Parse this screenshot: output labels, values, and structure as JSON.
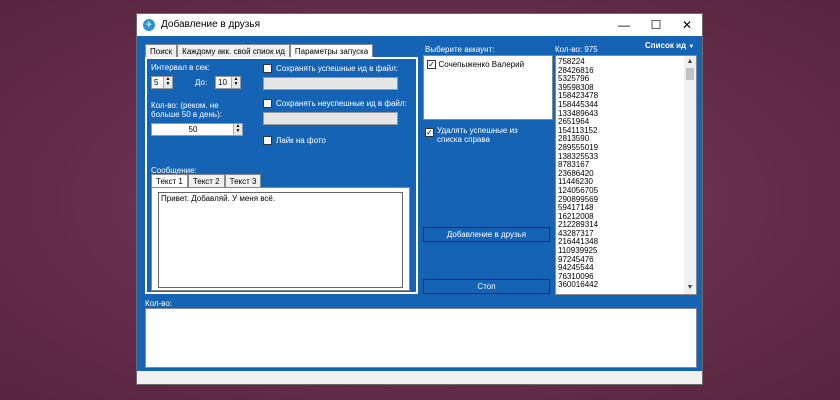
{
  "window": {
    "title": "Добавление в друзья"
  },
  "main_tabs": [
    "Поиск",
    "Каждому акк. свой спиок ид",
    "Параметры запуска"
  ],
  "params": {
    "interval_label": "Интервал в сек:",
    "interval_from": "5",
    "to_label": "До:",
    "interval_to": "10",
    "count_label": "Кол-во: (реком. не больше 50 в день):",
    "count_value": "50",
    "save_success_label": "Сохранять успешные ид в файл:",
    "save_fail_label": "Сохранять неуспешные ид в файл:",
    "like_photo_label": "Лайк на фото",
    "message_label": "Сообщение:"
  },
  "message_tabs": [
    "Текст 1",
    "Текст 2",
    "Текст 3"
  ],
  "message_text": "Привет. Добавляй. У меня всё.",
  "accounts": {
    "label": "Выберите аккаунт:",
    "items": [
      {
        "name": "Сочепыженко Валерий",
        "checked": true
      }
    ]
  },
  "remove_success_label": "Удалять успешные из списка справа",
  "add_button": "Добавление в друзья",
  "stop_button": "Стоп",
  "list": {
    "count_label": "Кол-во: 975",
    "dropdown_label": "Список ид",
    "ids": [
      "758224",
      "28426816",
      "5325796",
      "39598308",
      "158423478",
      "158445344",
      "133489643",
      "2651964",
      "154113152",
      "2813590",
      "289555019",
      "138325533",
      "8783167",
      "23686420",
      "11446230",
      "124056705",
      "290899569",
      "59417148",
      "16212008",
      "212289314",
      "43287317",
      "216441348",
      "110939925",
      "97245476",
      "94245544",
      "76310096",
      "360016442"
    ]
  },
  "bottom": {
    "count_label": "Кол-во:"
  },
  "colors": {
    "window_bg": "#1463b5",
    "accent": "#2a93d5"
  }
}
